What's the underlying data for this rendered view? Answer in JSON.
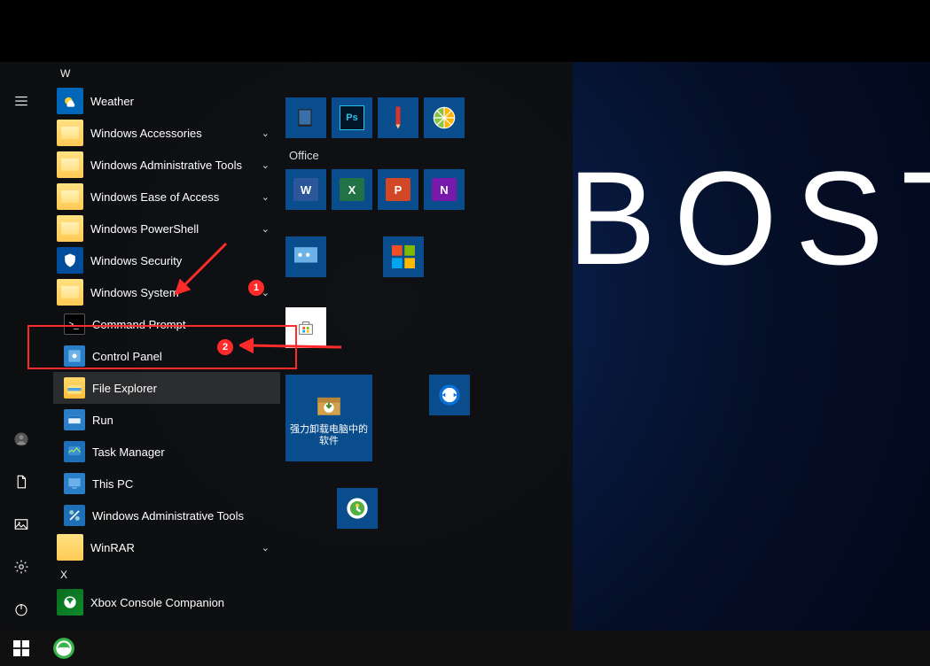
{
  "desktop": {
    "bg_text": "BOST"
  },
  "letters": {
    "W": "W",
    "X": "X"
  },
  "apps": [
    {
      "key": "weather",
      "label": "Weather"
    },
    {
      "key": "win-accessories",
      "label": "Windows Accessories",
      "expandable": true
    },
    {
      "key": "win-admin-tools",
      "label": "Windows Administrative Tools",
      "expandable": true
    },
    {
      "key": "win-ease",
      "label": "Windows Ease of Access",
      "expandable": true
    },
    {
      "key": "win-powershell",
      "label": "Windows PowerShell",
      "expandable": true
    },
    {
      "key": "win-security",
      "label": "Windows Security"
    },
    {
      "key": "win-system",
      "label": "Windows System",
      "expandable": true,
      "expanded": true
    },
    {
      "key": "cmd",
      "label": "Command Prompt",
      "sub": true
    },
    {
      "key": "control-panel",
      "label": "Control Panel",
      "sub": true
    },
    {
      "key": "file-explorer",
      "label": "File Explorer",
      "sub": true,
      "hover": true
    },
    {
      "key": "run",
      "label": "Run",
      "sub": true
    },
    {
      "key": "task-manager",
      "label": "Task Manager",
      "sub": true
    },
    {
      "key": "this-pc",
      "label": "This PC",
      "sub": true
    },
    {
      "key": "admin-tools-sub",
      "label": "Windows Administrative Tools",
      "sub": true
    },
    {
      "key": "winrar",
      "label": "WinRAR",
      "expandable": true
    },
    {
      "key": "xbox",
      "label": "Xbox Console Companion"
    }
  ],
  "tiles": {
    "row1": [
      "tablet",
      "photoshop",
      "pencil",
      "citrus"
    ],
    "office_label": "Office",
    "office": [
      "word",
      "excel",
      "powerpoint",
      "onenote"
    ],
    "row3": [
      "control-panel-tile",
      "colors-tile"
    ],
    "store": "store",
    "med1_label": "强力卸载电脑中的软件",
    "teamviewer": "teamviewer",
    "qq": "qq"
  },
  "annotations": {
    "badge1": "1",
    "badge2": "2"
  }
}
